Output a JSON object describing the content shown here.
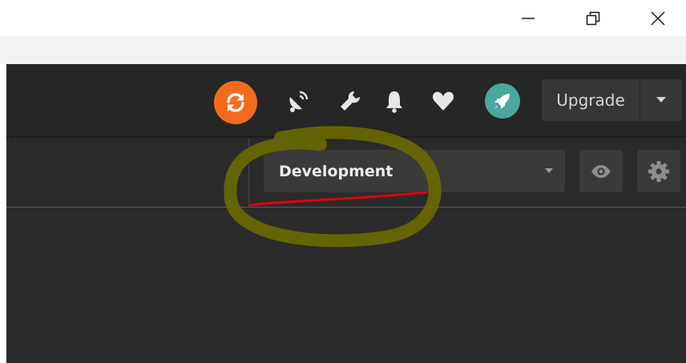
{
  "window": {
    "minimize_icon": "minimize-icon",
    "restore_icon": "restore-icon",
    "close_icon": "close-icon"
  },
  "header": {
    "icons": [
      "sync-icon",
      "satellite-dish-icon",
      "wrench-icon",
      "bell-icon",
      "heart-icon",
      "rocket-icon"
    ],
    "upgrade_label": "Upgrade"
  },
  "toolbar": {
    "environment_selected": "Development",
    "icons": [
      "eye-icon",
      "gear-icon"
    ]
  },
  "colors": {
    "header_bg": "#262626",
    "content_bg": "#2b2b2b",
    "sync_orange": "#f26b1d",
    "rocket_teal": "#49a89c",
    "annotation_circle": "#6b6a00",
    "annotation_underline": "#e0000b"
  }
}
